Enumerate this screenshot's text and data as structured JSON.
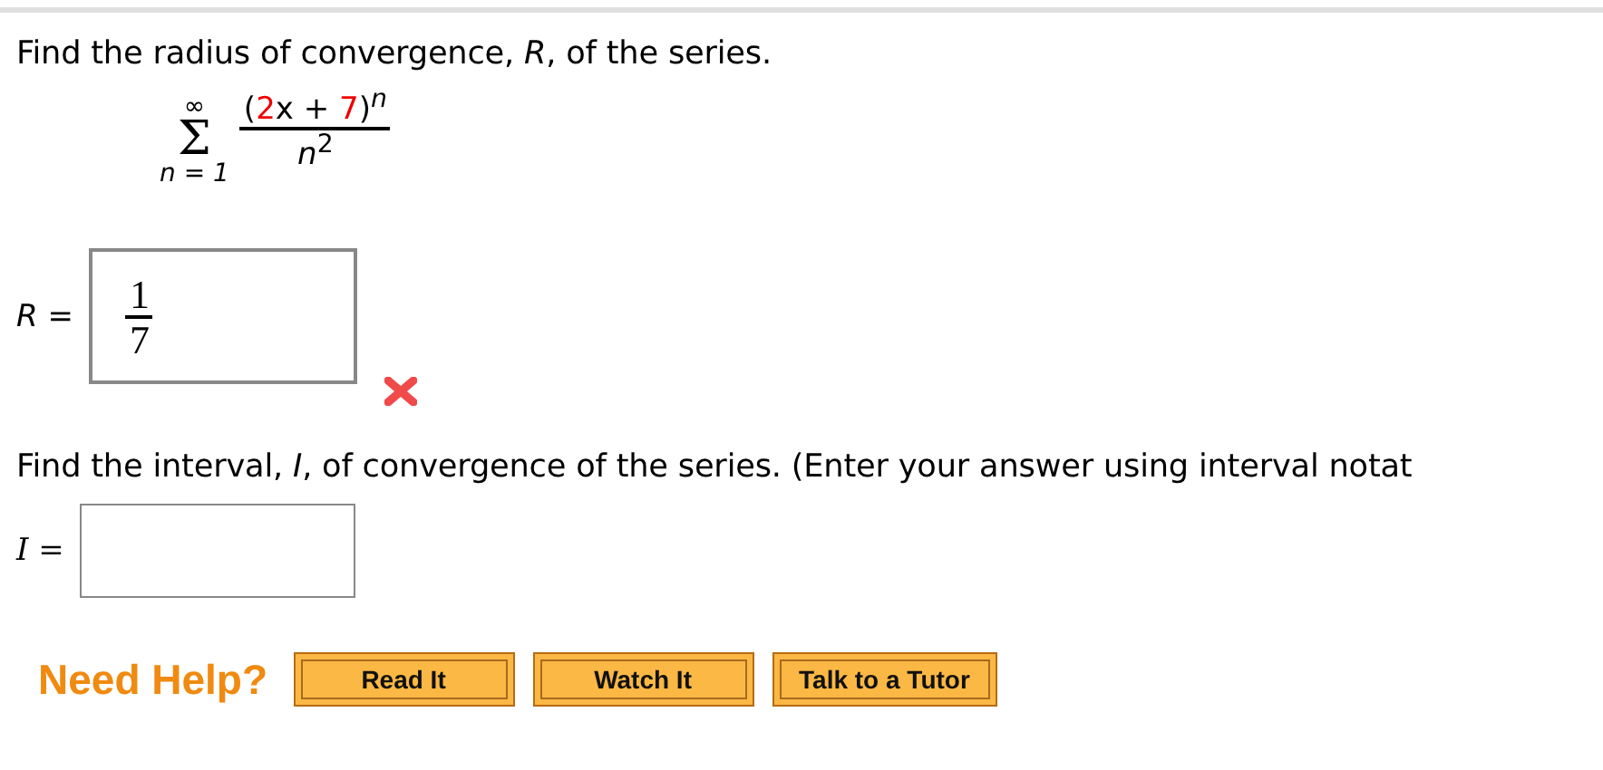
{
  "radius_question": {
    "prompt": "Find the radius of convergence, *R*, of the series.",
    "series": {
      "upper": "∞",
      "sigma": "Σ",
      "lower": "n = 1",
      "numerator": [
        {
          "text": "(",
          "highlighted": false
        },
        {
          "text": "2",
          "highlighted": true
        },
        {
          "text": "x + ",
          "highlighted": false
        },
        {
          "text": "7",
          "highlighted": true
        },
        {
          "text": ")",
          "highlighted": false
        }
      ],
      "numerator_exponent": "n",
      "denominator": "*n*$^{2}$"
    },
    "answer_label": "*R* =",
    "answer": {
      "numerator": "1",
      "denominator": "7"
    },
    "correct": false
  },
  "interval_question": {
    "prompt": "Find the interval, *I*, of convergence of the series. (Enter your answer using interval notat",
    "answer_label": "I ="
  },
  "help": {
    "label": "Need Help?",
    "buttons": [
      "Read It",
      "Watch It",
      "Talk to a Tutor"
    ]
  }
}
